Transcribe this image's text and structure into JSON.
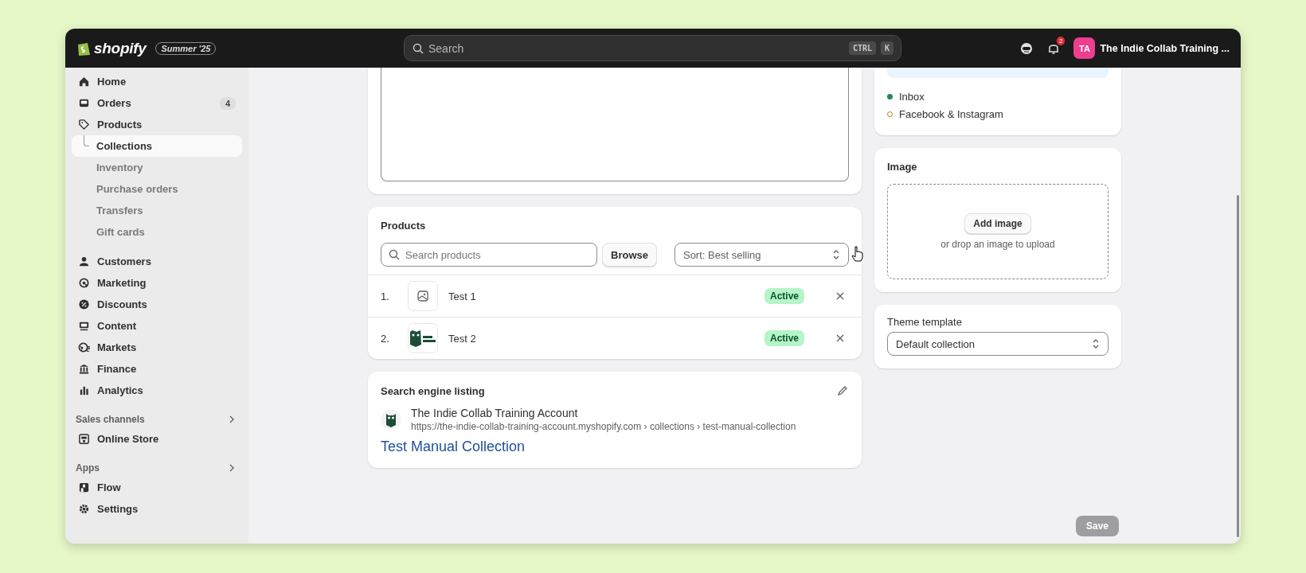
{
  "topbar": {
    "logo": "shopify",
    "edition": "Summer '25",
    "search": {
      "placeholder": "Search",
      "keys": [
        "CTRL",
        "K"
      ]
    },
    "notifications": "2",
    "avatar": "TA",
    "store": "The Indie Collab Training ..."
  },
  "sidebar": {
    "groups": [
      {
        "items": [
          {
            "label": "Home",
            "selected": false
          },
          {
            "label": "Orders",
            "badge": "4",
            "selected": false
          },
          {
            "label": "Products",
            "selected": false,
            "children": [
              {
                "label": "Collections",
                "selected": true
              },
              {
                "label": "Inventory",
                "selected": false
              },
              {
                "label": "Purchase orders",
                "selected": false
              },
              {
                "label": "Transfers",
                "selected": false
              },
              {
                "label": "Gift cards",
                "selected": false
              }
            ]
          }
        ]
      },
      {
        "items": [
          {
            "label": "Customers",
            "selected": false
          },
          {
            "label": "Marketing",
            "selected": false
          },
          {
            "label": "Discounts",
            "selected": false
          },
          {
            "label": "Content",
            "selected": false
          },
          {
            "label": "Markets",
            "selected": false
          },
          {
            "label": "Finance",
            "selected": false
          },
          {
            "label": "Analytics",
            "selected": false
          }
        ]
      },
      {
        "heading": "Sales channels",
        "items": [
          {
            "label": "Online Store",
            "selected": false
          }
        ]
      },
      {
        "heading": "Apps",
        "items": [
          {
            "label": "Flow",
            "selected": false
          },
          {
            "label": "Settings",
            "selected": false
          }
        ]
      }
    ]
  },
  "products": {
    "title": "Products",
    "search_placeholder": "Search products",
    "browse": "Browse",
    "sort": "Sort: Best selling",
    "rows": [
      {
        "number": "1.",
        "name": "Test 1",
        "status": "Active",
        "kind": "placeholder"
      },
      {
        "number": "2.",
        "name": "Test 2",
        "status": "Active",
        "kind": "picture"
      }
    ]
  },
  "seo": {
    "title": "Search engine listing",
    "store": "The Indie Collab Training Account",
    "url": "https://the-indie-collab-training-account.myshopify.com › collections › test-manual-collection",
    "page_title": "Test Manual Collection"
  },
  "channels": [
    {
      "name": "Inbox",
      "published": true
    },
    {
      "name": "Facebook & Instagram",
      "published": false
    }
  ],
  "image": {
    "title": "Image",
    "button": "Add image",
    "hint": "or drop an image to upload"
  },
  "theme": {
    "label": "Theme template",
    "value": "Default collection"
  },
  "save": {
    "label": "Save",
    "disabled": true
  }
}
